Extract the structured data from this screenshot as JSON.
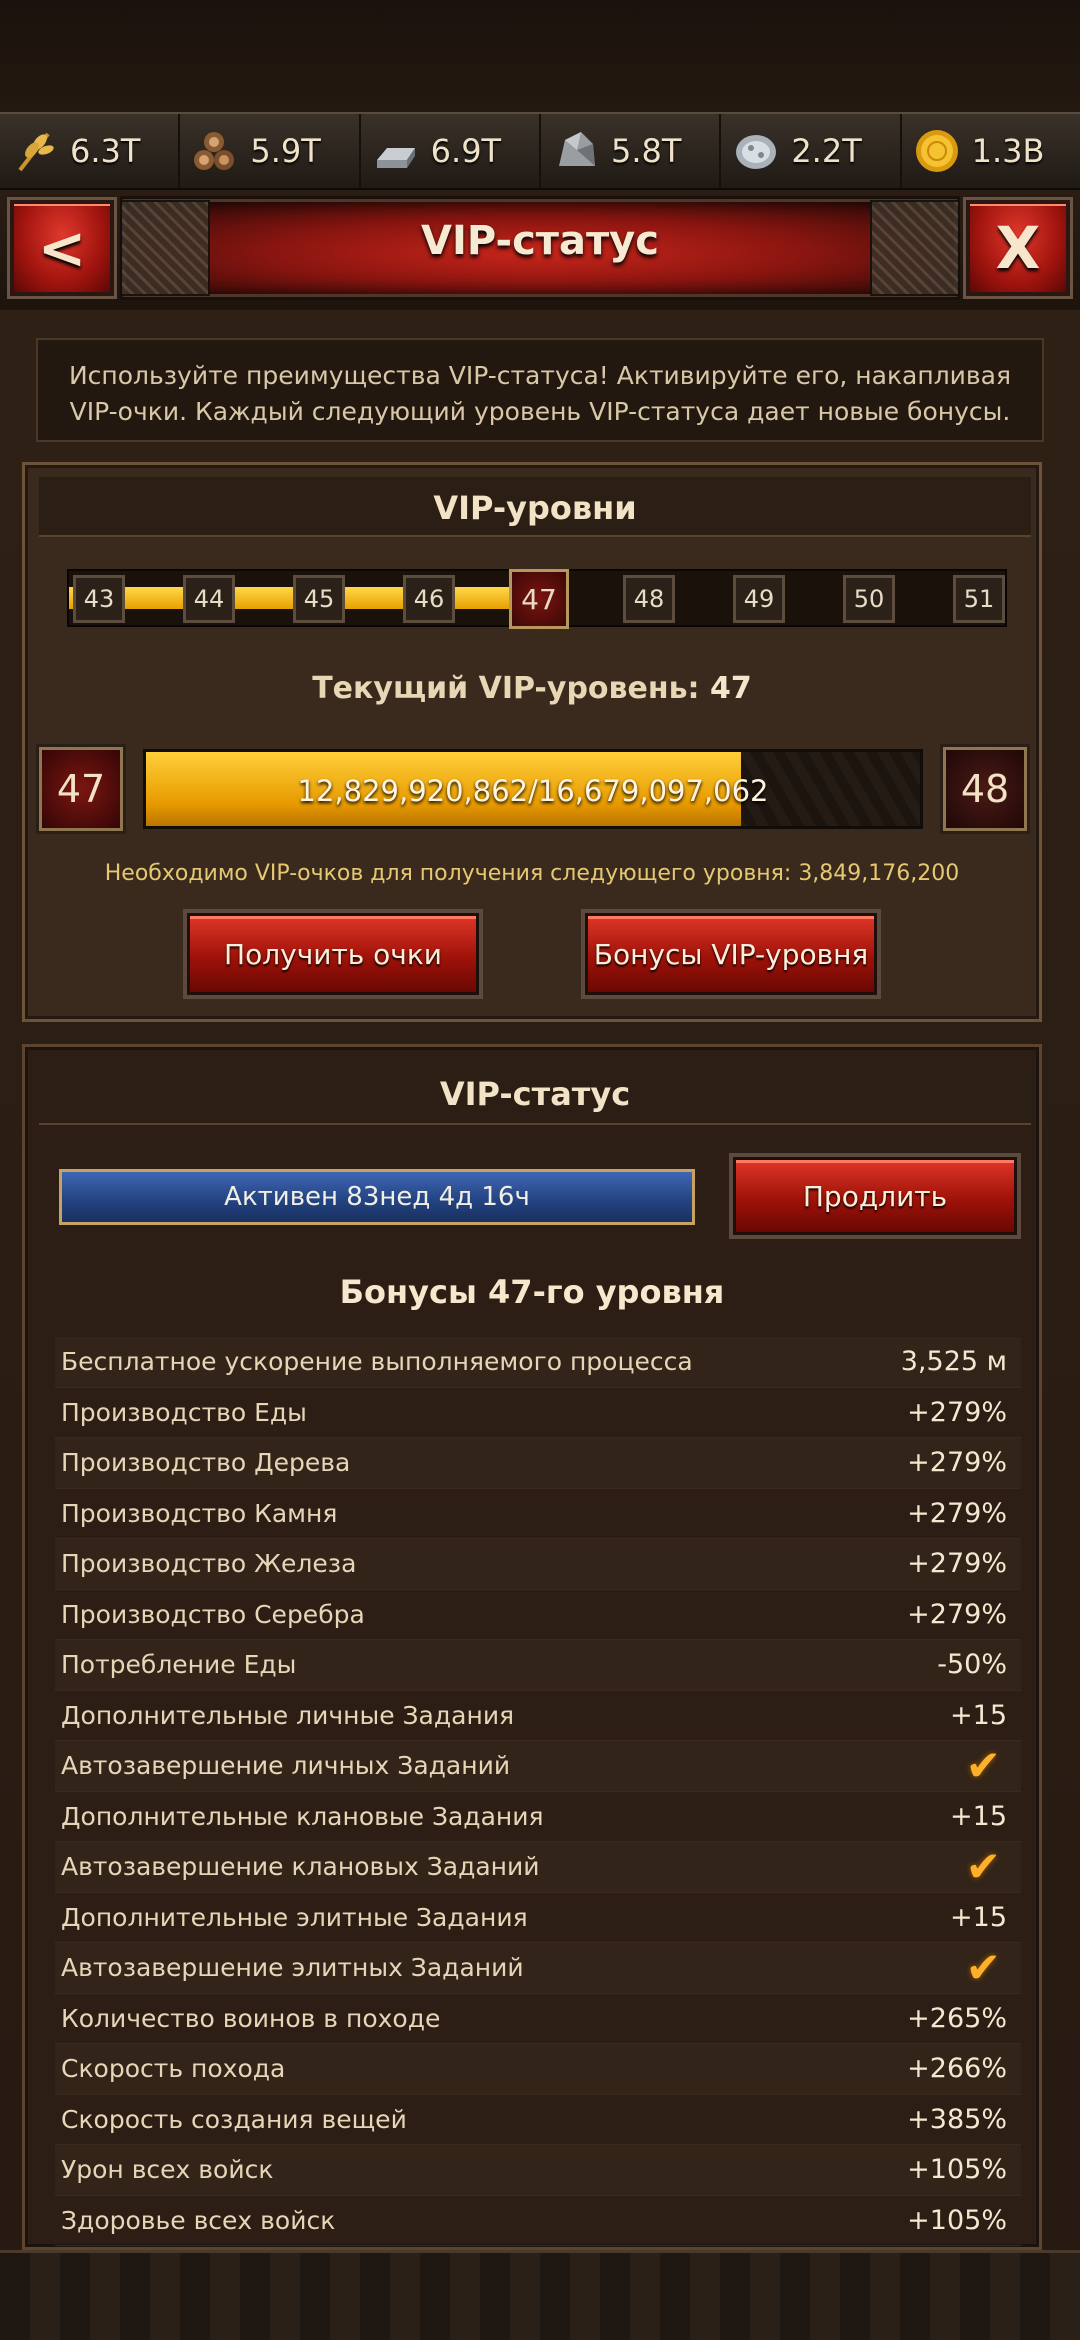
{
  "resources": [
    {
      "icon": "wheat-icon",
      "value": "6.3T"
    },
    {
      "icon": "wood-logs-icon",
      "value": "5.9T"
    },
    {
      "icon": "iron-ingot-icon",
      "value": "6.9T"
    },
    {
      "icon": "stone-icon",
      "value": "5.8T"
    },
    {
      "icon": "silver-ore-icon",
      "value": "2.2T"
    },
    {
      "icon": "gold-coin-icon",
      "value": "1.3B"
    }
  ],
  "header": {
    "title": "VIP-статус",
    "back_label": "<",
    "close_label": "X"
  },
  "intro": "Используйте преимущества VIP-статуса! Активируйте его, накапливая VIP-очки. Каждый следующий уровень VIP-статуса дает новые бонусы.",
  "levels_panel": {
    "title": "VIP-уровни",
    "track_levels": [
      "43",
      "44",
      "45",
      "46",
      "47",
      "48",
      "49",
      "50",
      "51"
    ],
    "current_index": 4,
    "current_label": "Текущий VIP-уровень:",
    "current_level": "47",
    "next_level": "48",
    "progress_text": "12,829,920,862/16,679,097,062",
    "progress_fraction": 0.7692,
    "need_text": "Необходимо VIP-очков для получения следующего уровня: 3,849,176,200",
    "get_points_label": "Получить очки",
    "level_bonuses_label": "Бонусы VIP-уровня"
  },
  "vip_panel": {
    "title": "VIP-статус",
    "active_text": "Активен 83нед 4д 16ч",
    "extend_label": "Продлить",
    "bonus_title": "Бонусы 47-го уровня",
    "bonuses": [
      {
        "name": "Бесплатное ускорение выполняемого процесса",
        "value": "3,525 м"
      },
      {
        "name": "Производство Еды",
        "value": "+279%"
      },
      {
        "name": "Производство Дерева",
        "value": "+279%"
      },
      {
        "name": "Производство Камня",
        "value": "+279%"
      },
      {
        "name": "Производство Железа",
        "value": "+279%"
      },
      {
        "name": "Производство Серебра",
        "value": "+279%"
      },
      {
        "name": "Потребление Еды",
        "value": "-50%"
      },
      {
        "name": "Дополнительные личные Задания",
        "value": "+15"
      },
      {
        "name": "Автозавершение личных Заданий",
        "value": "✔"
      },
      {
        "name": "Дополнительные клановые Задания",
        "value": "+15"
      },
      {
        "name": "Автозавершение клановых Заданий",
        "value": "✔"
      },
      {
        "name": "Дополнительные элитные Задания",
        "value": "+15"
      },
      {
        "name": "Автозавершение элитных Заданий",
        "value": "✔"
      },
      {
        "name": "Количество воинов в походе",
        "value": "+265%"
      },
      {
        "name": "Скорость похода",
        "value": "+266%"
      },
      {
        "name": "Скорость создания вещей",
        "value": "+385%"
      },
      {
        "name": "Урон всех войск",
        "value": "+105%"
      },
      {
        "name": "Здоровье всех войск",
        "value": "+105%"
      }
    ]
  }
}
